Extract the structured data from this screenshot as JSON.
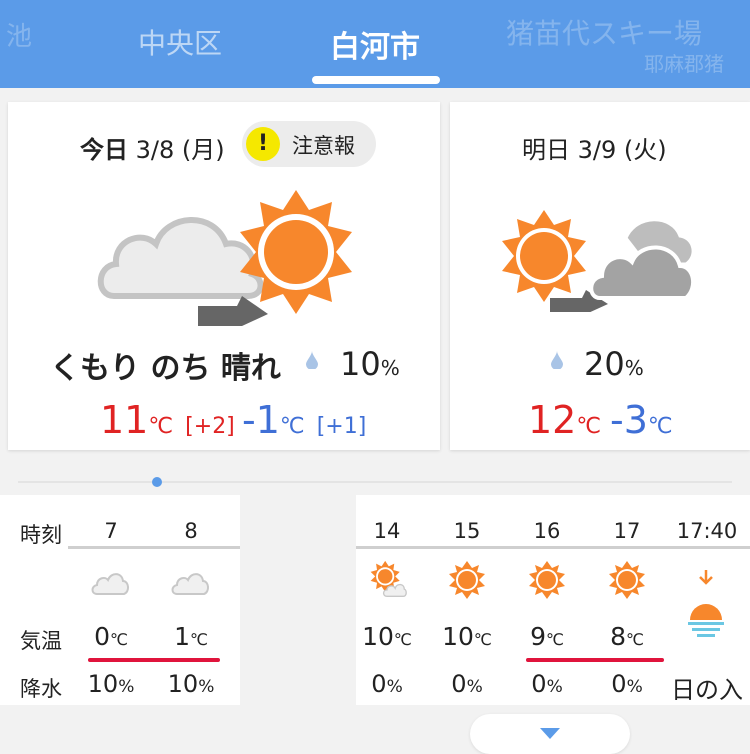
{
  "header": {
    "locations": {
      "prev_partial": "池",
      "left": "中央区",
      "current": "白河市",
      "right": "猪苗代スキー場",
      "right_sub": "耶麻郡猪"
    }
  },
  "today": {
    "label_bold": "今日",
    "date": "3/8 (月)",
    "warning": {
      "icon": "!",
      "text": "注意報"
    },
    "weather_text": "くもり のち 晴れ",
    "precip_value": "10",
    "precip_unit": "%",
    "high": {
      "value": "11",
      "unit": "℃",
      "diff": "[+2]"
    },
    "low": {
      "value": "-1",
      "unit": "℃",
      "diff": "[+1]"
    }
  },
  "tomorrow": {
    "label": "明日 3/9 (火)",
    "precip_value": "20",
    "precip_unit": "%",
    "high": {
      "value": "12",
      "unit": "℃"
    },
    "low": {
      "value": "-3",
      "unit": "℃"
    }
  },
  "hourly": {
    "labels": {
      "time": "時刻",
      "temp": "気温",
      "precip": "降水"
    },
    "hours": [
      {
        "time": "7",
        "icon": "cloud-icon",
        "temp": "0",
        "precip": "10"
      },
      {
        "time": "8",
        "icon": "cloud-icon",
        "temp": "1",
        "precip": "10"
      },
      {
        "time": "14",
        "icon": "sun-cloud-icon",
        "temp": "10",
        "precip": "0"
      },
      {
        "time": "15",
        "icon": "sun-icon",
        "temp": "10",
        "precip": "0"
      },
      {
        "time": "16",
        "icon": "sun-icon",
        "temp": "9",
        "precip": "0"
      },
      {
        "time": "17",
        "icon": "sun-icon",
        "temp": "8",
        "precip": "0"
      }
    ],
    "sunset": {
      "time": "17:40",
      "icon": "sunset-icon",
      "label": "日の入"
    },
    "temp_unit": "℃",
    "precip_unit": "%"
  },
  "colors": {
    "header": "#5b9be8",
    "high": "#e02323",
    "low": "#3f6fd6",
    "sun": "#f7872c",
    "warning": "#f5e800",
    "underline": "#e0143c"
  }
}
